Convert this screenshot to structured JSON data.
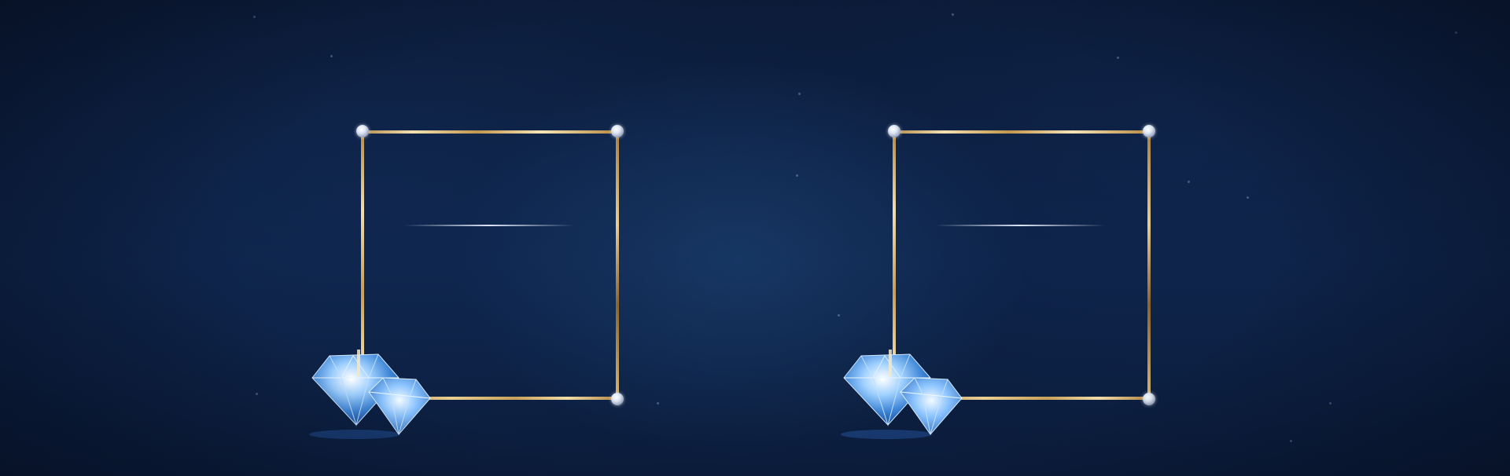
{
  "scene": {
    "background_color": "#0c1c39",
    "frame_color": "#d9b978",
    "gem_color": "#5aa8ff"
  },
  "frames": [
    {
      "id": "left",
      "icon": "diamond-icon"
    },
    {
      "id": "right",
      "icon": "diamond-icon"
    }
  ]
}
